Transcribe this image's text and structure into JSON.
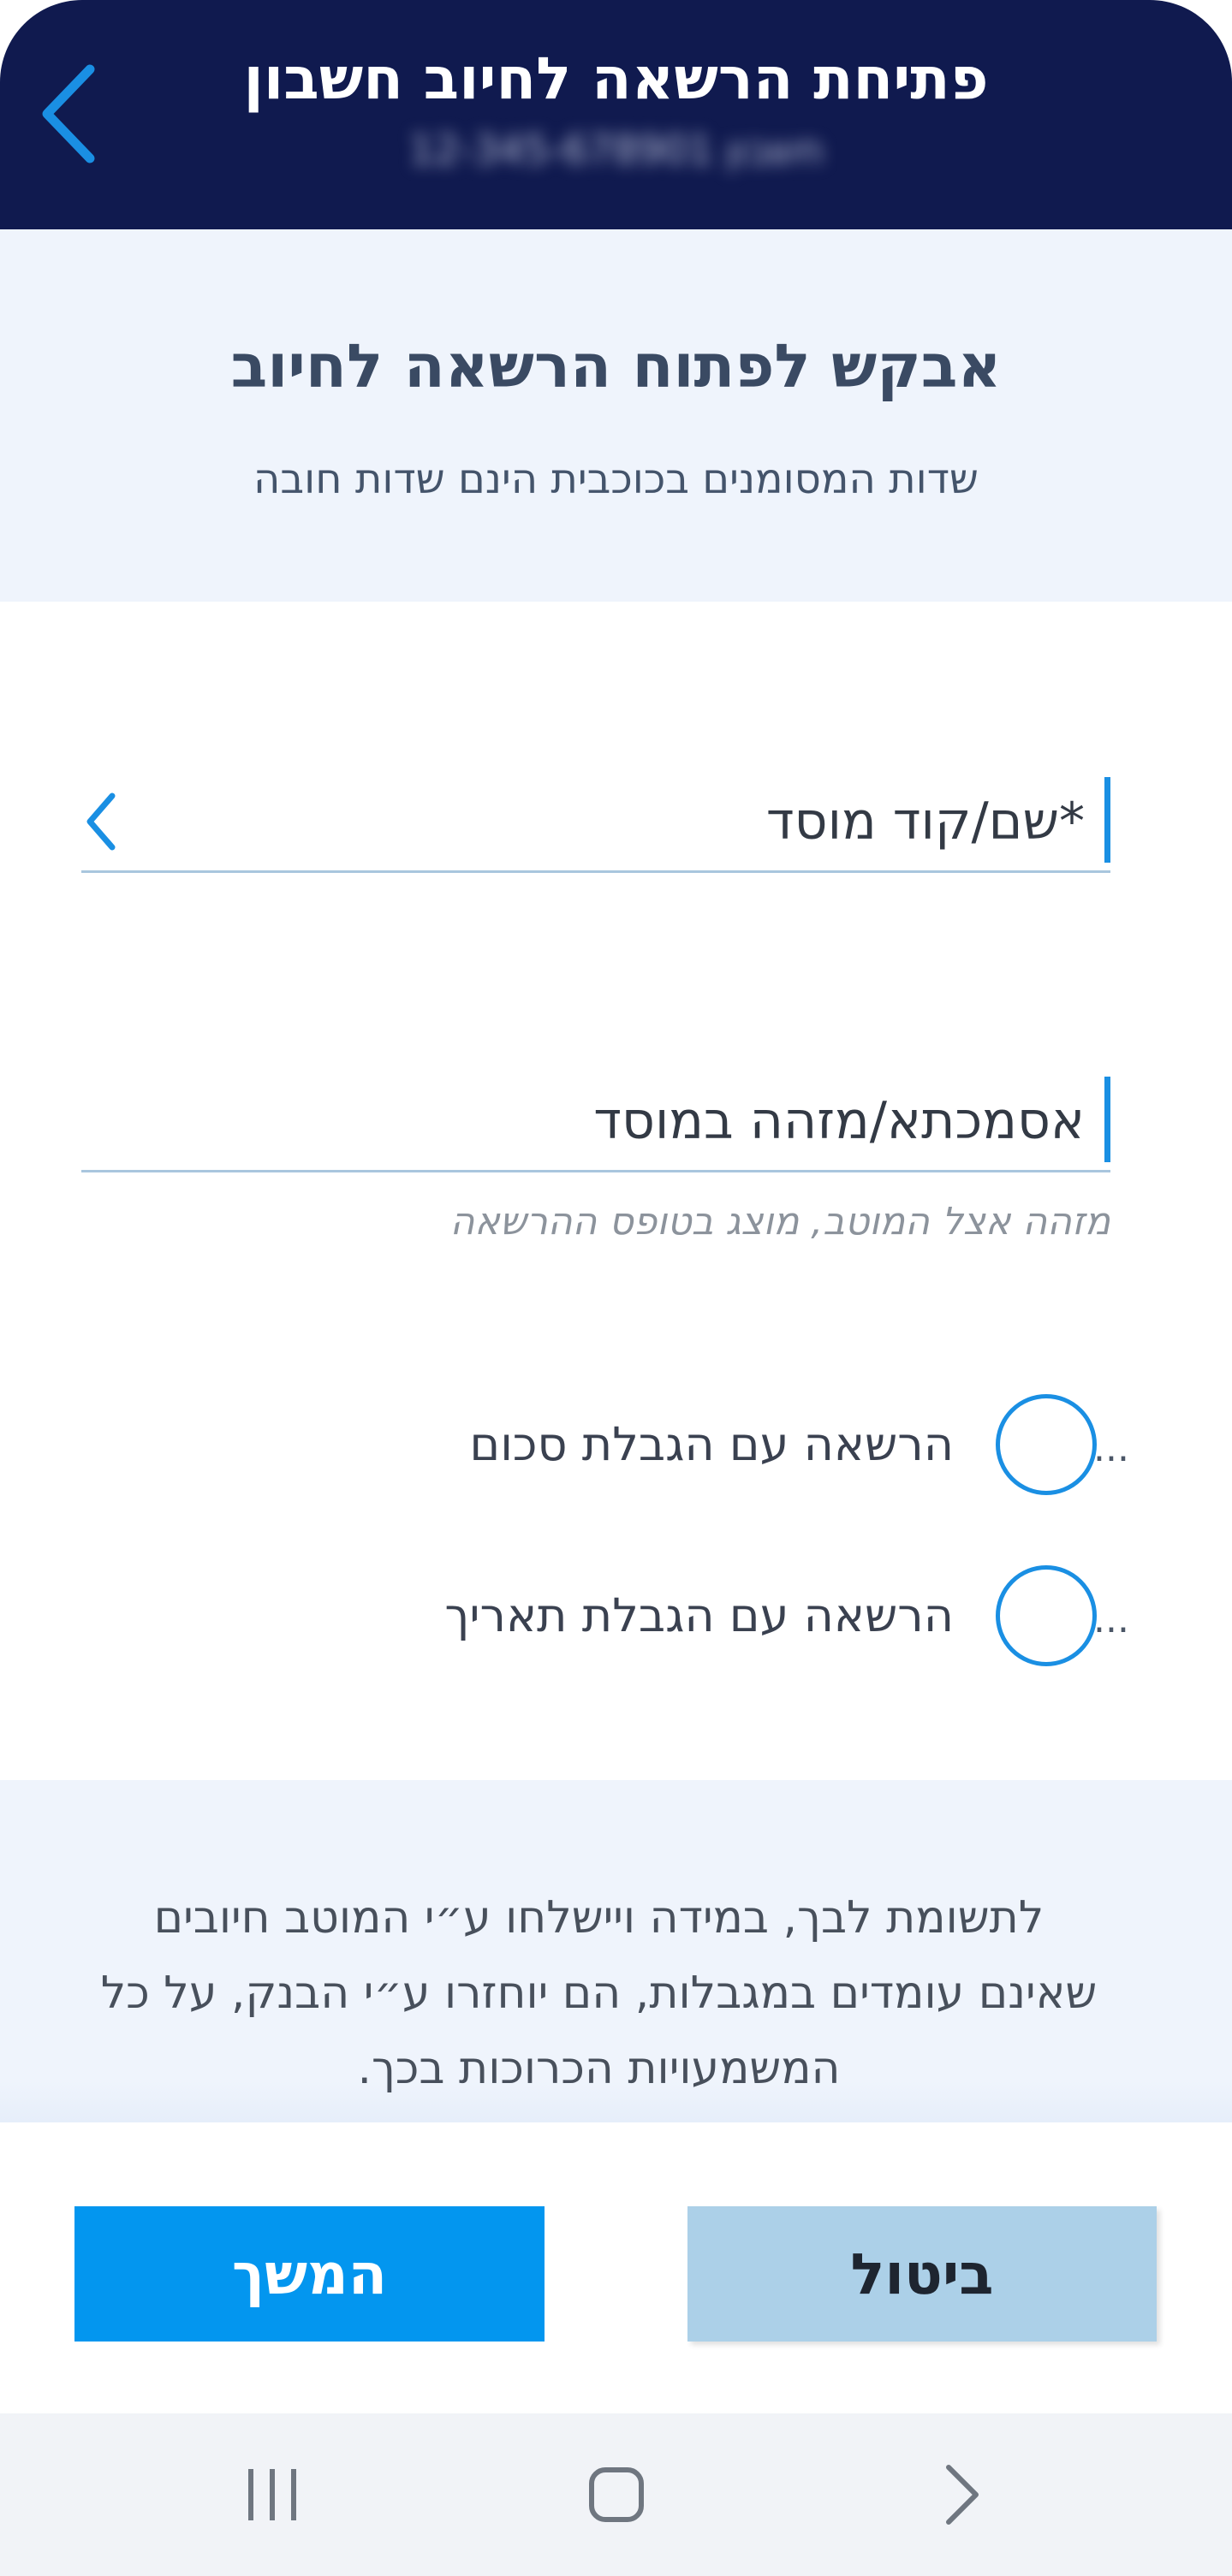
{
  "header": {
    "title": "פתיחת הרשאה לחיוב חשבון",
    "account_line": "חשבון 12-345-678901",
    "back_icon": "chevron-left-icon"
  },
  "intro": {
    "title": "אבקש לפתוח הרשאה לחיוב",
    "subtitle": "שדות המסומנים בכוכבית הינם שדות חובה"
  },
  "fields": {
    "institution": {
      "label": "*שם/קוד מוסד",
      "chevron_icon": "chevron-left-icon"
    },
    "reference": {
      "label": "אסמכתא/מזהה במוסד",
      "hint": "מזהה אצל המוטב, מוצג בטופס ההרשאה"
    }
  },
  "options": [
    {
      "label": "הרשאה עם הגבלת סכום",
      "dots": "...",
      "selected": false
    },
    {
      "label": "הרשאה עם הגבלת תאריך",
      "dots": "...",
      "selected": false
    }
  ],
  "notice": {
    "text": "לתשומת לבך, במידה ויישלחו ע״י המוטב חיובים שאינם עומדים במגבלות, הם יוחזרו ע״י הבנק, על כל המשמעויות הכרוכות בכך."
  },
  "buttons": {
    "cancel_label": "ביטול",
    "continue_label": "המשך"
  },
  "system_nav": {
    "recents_icon": "recent-apps-icon",
    "home_icon": "home-icon",
    "back_icon": "back-chevron-icon"
  },
  "colors": {
    "header_bg": "#101a4f",
    "accent": "#1a8fe3",
    "primary_button": "#0396ef",
    "secondary_button": "#acd0e8",
    "band_bg": "#eff4fc"
  }
}
